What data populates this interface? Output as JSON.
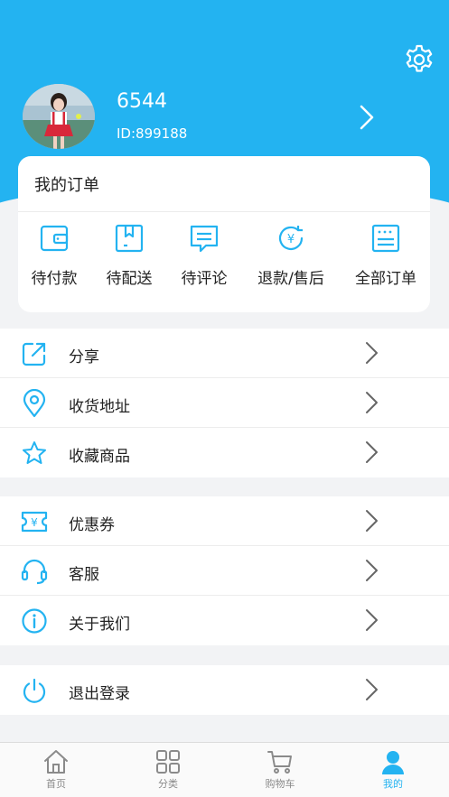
{
  "user": {
    "name": "6544",
    "id_text": "ID:899188"
  },
  "colors": {
    "accent": "#23b3f1",
    "background": "#f2f3f5"
  },
  "orders": {
    "title": "我的订单",
    "items": [
      {
        "label": "待付款",
        "icon": "wallet-icon"
      },
      {
        "label": "待配送",
        "icon": "box-icon"
      },
      {
        "label": "待评论",
        "icon": "comment-icon"
      },
      {
        "label": "退款/售后",
        "icon": "refund-icon"
      },
      {
        "label": "全部订单",
        "icon": "order-list-icon"
      }
    ]
  },
  "menu": {
    "group1": [
      {
        "label": "分享",
        "icon": "share-icon"
      },
      {
        "label": "收货地址",
        "icon": "location-icon"
      },
      {
        "label": "收藏商品",
        "icon": "star-icon"
      }
    ],
    "group2": [
      {
        "label": "优惠券",
        "icon": "coupon-icon"
      },
      {
        "label": "客服",
        "icon": "headset-icon"
      },
      {
        "label": "关于我们",
        "icon": "info-icon"
      }
    ],
    "group3": [
      {
        "label": "退出登录",
        "icon": "power-icon"
      }
    ]
  },
  "tabbar": {
    "items": [
      {
        "label": "首页",
        "icon": "home-icon"
      },
      {
        "label": "分类",
        "icon": "category-icon"
      },
      {
        "label": "购物车",
        "icon": "cart-icon"
      },
      {
        "label": "我的",
        "icon": "user-icon",
        "active": true
      }
    ]
  }
}
